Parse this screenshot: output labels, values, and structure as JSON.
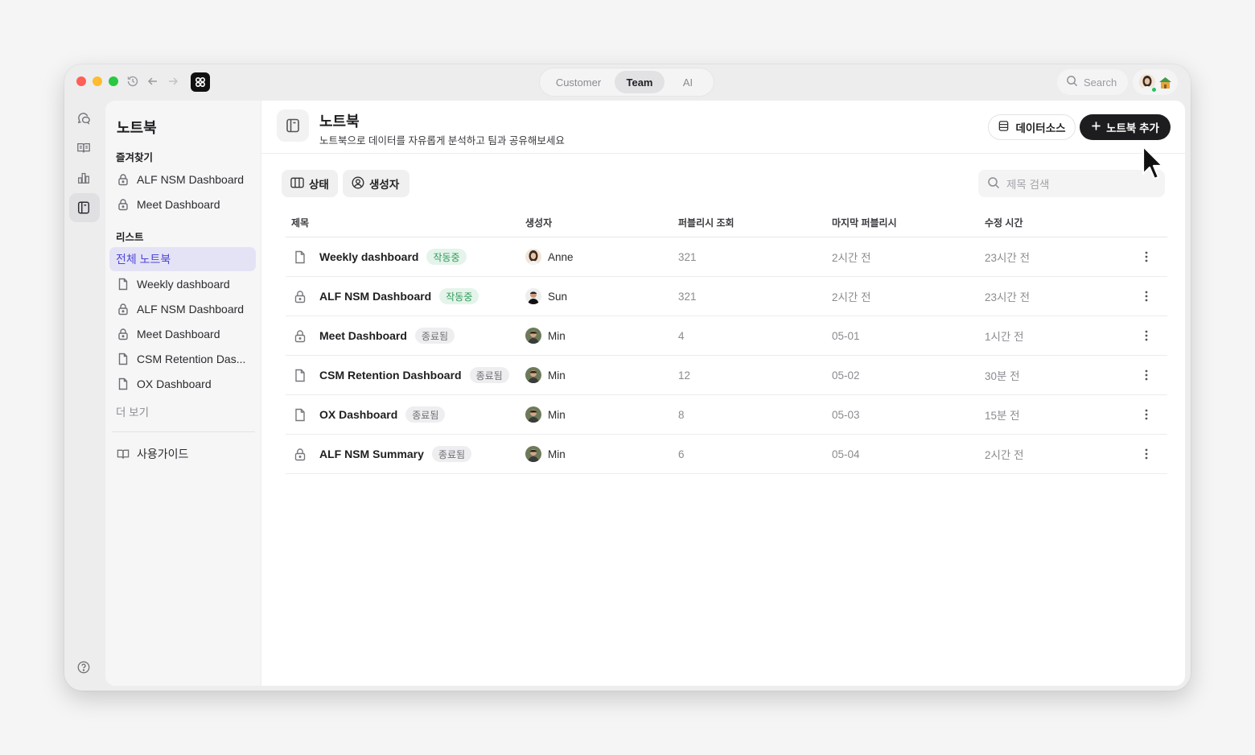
{
  "topbar": {
    "tabs": [
      {
        "label": "Customer",
        "active": false
      },
      {
        "label": "Team",
        "active": true
      },
      {
        "label": "AI",
        "active": false
      }
    ],
    "search_label": "Search"
  },
  "sidebar": {
    "title": "노트북",
    "favorites_label": "즐겨찾기",
    "favorites": [
      {
        "label": "ALF NSM Dashboard",
        "icon": "lock-icon"
      },
      {
        "label": "Meet Dashboard",
        "icon": "lock-icon"
      }
    ],
    "list_label": "리스트",
    "all_label": "전체 노트북",
    "items": [
      {
        "label": "Weekly dashboard",
        "icon": "document-icon"
      },
      {
        "label": "ALF NSM Dashboard",
        "icon": "lock-icon"
      },
      {
        "label": "Meet Dashboard",
        "icon": "lock-icon"
      },
      {
        "label": "CSM Retention Das...",
        "icon": "document-icon"
      },
      {
        "label": "OX Dashboard",
        "icon": "document-icon"
      }
    ],
    "more_label": "더 보기",
    "guide_label": "사용가이드"
  },
  "header": {
    "title": "노트북",
    "subtitle": "노트북으로 데이터를 자유롭게 분석하고 팀과 공유해보세요",
    "datasource_label": "데이터소스",
    "add_label": "노트북 추가"
  },
  "filters": {
    "status_label": "상태",
    "creator_label": "생성자",
    "search_placeholder": "제목 검색"
  },
  "table": {
    "columns": [
      "제목",
      "생성자",
      "퍼블리시 조회",
      "마지막 퍼블리시",
      "수정 시간"
    ],
    "rows": [
      {
        "icon": "document-icon",
        "title": "Weekly dashboard",
        "status": "작동중",
        "status_type": "live",
        "creator": "Anne",
        "views": "321",
        "last_published": "2시간 전",
        "modified": "23시간 전"
      },
      {
        "icon": "lock-icon",
        "title": "ALF NSM Dashboard",
        "status": "작동중",
        "status_type": "live",
        "creator": "Sun",
        "views": "321",
        "last_published": "2시간 전",
        "modified": "23시간 전"
      },
      {
        "icon": "lock-icon",
        "title": "Meet Dashboard",
        "status": "종료됨",
        "status_type": "done",
        "creator": "Min",
        "views": "4",
        "last_published": "05-01",
        "modified": "1시간 전"
      },
      {
        "icon": "document-icon",
        "title": "CSM Retention Dashboard",
        "status": "종료됨",
        "status_type": "done",
        "creator": "Min",
        "views": "12",
        "last_published": "05-02",
        "modified": "30분 전"
      },
      {
        "icon": "document-icon",
        "title": "OX Dashboard",
        "status": "종료됨",
        "status_type": "done",
        "creator": "Min",
        "views": "8",
        "last_published": "05-03",
        "modified": "15분 전"
      },
      {
        "icon": "lock-icon",
        "title": "ALF NSM Summary",
        "status": "종료됨",
        "status_type": "done",
        "creator": "Min",
        "views": "6",
        "last_published": "05-04",
        "modified": "2시간 전"
      }
    ]
  },
  "colors": {
    "accent": "#4f46d8",
    "live_badge": "#2f9a59",
    "done_badge": "#6f6f75",
    "primary_button": "#1d1d20"
  }
}
